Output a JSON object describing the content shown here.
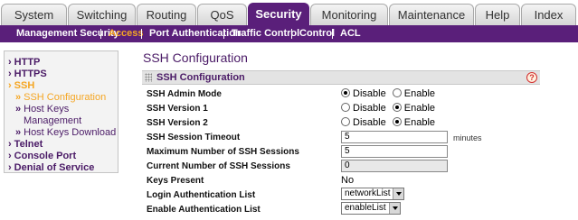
{
  "tabs": [
    "System",
    "Switching",
    "Routing",
    "QoS",
    "Security",
    "Monitoring",
    "Maintenance",
    "Help",
    "Index"
  ],
  "active_tab": "Security",
  "submenu": [
    "Management Security",
    "Access",
    "Port Authentication",
    "Traffic Control",
    "Control",
    "ACL"
  ],
  "active_submenu": "Access",
  "leftnav": {
    "http": "HTTP",
    "https": "HTTPS",
    "ssh": "SSH",
    "ssh_config": "SSH Configuration",
    "host_keys": "Host Keys",
    "management": "Management",
    "host_keys_download": "Host Keys Download",
    "telnet": "Telnet",
    "console_port": "Console Port",
    "denial_of_service": "Denial of Service"
  },
  "page_title": "SSH Configuration",
  "section_title": "SSH Configuration",
  "help_glyph": "?",
  "form": {
    "admin_mode": {
      "label": "SSH Admin Mode",
      "options": [
        "Disable",
        "Enable"
      ],
      "selected": "Disable"
    },
    "version1": {
      "label": "SSH Version 1",
      "options": [
        "Disable",
        "Enable"
      ],
      "selected": "Enable"
    },
    "version2": {
      "label": "SSH Version 2",
      "options": [
        "Disable",
        "Enable"
      ],
      "selected": "Enable"
    },
    "session_timeout": {
      "label": "SSH Session Timeout",
      "value": "5",
      "unit": "minutes"
    },
    "max_sessions": {
      "label": "Maximum Number of SSH Sessions",
      "value": "5"
    },
    "current_sessions": {
      "label": "Current Number of SSH Sessions",
      "value": "0"
    },
    "keys_present": {
      "label": "Keys Present",
      "value": "No"
    },
    "login_auth": {
      "label": "Login Authentication List",
      "value": "networkList"
    },
    "enable_auth": {
      "label": "Enable Authentication List",
      "value": "enableList"
    }
  },
  "colors": {
    "brand_purple": "#5a1f7a",
    "accent_orange": "#f5a623"
  }
}
